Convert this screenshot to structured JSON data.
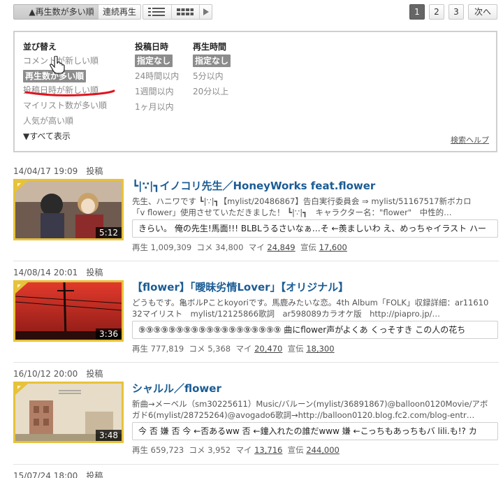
{
  "toolbar": {
    "sort_button": "▲再生数が多い順",
    "continuous_play": "連続再生",
    "pages": [
      "1",
      "2",
      "3"
    ],
    "next": "次へ"
  },
  "filter": {
    "sort": {
      "heading": "並び替え",
      "options": [
        "コメントが新しい順",
        "再生数が多い順",
        "投稿日時が新しい順",
        "マイリスト数が多い順",
        "人気が高い順"
      ],
      "show_all": "▼すべて表示"
    },
    "post_date": {
      "heading": "投稿日時",
      "selected": "指定なし",
      "options": [
        "24時間以内",
        "1週間以内",
        "1ヶ月以内"
      ]
    },
    "duration": {
      "heading": "再生時間",
      "selected": "指定なし",
      "options": [
        "5分以内",
        "20分以上"
      ]
    },
    "help": "検索ヘルプ"
  },
  "videos": [
    {
      "date": "14/04/17 19:09",
      "post_label": "投稿",
      "title": "┗|∵|┓イノコリ先生／HoneyWorks feat.flower",
      "desc1": "先生、ハニワです ┗|∵|┓【mylist/20486867】告白実行委員会 ⇒ mylist/51167517新ボカロ",
      "desc2": "「v flower」使用させていただきました！ ┗|∵|┓　キャラクター名：\"flower\"　中性的…",
      "duration": "5:12",
      "comment": "きらい。 俺の先生!馬面!!! BLBLうるさいなぁ…そ ←羨ましいわ え、めっちゃイラスト ハー",
      "views_label": "再生",
      "views": "1,009,309",
      "comments_label": "コメ",
      "comments": "34,800",
      "mylist_label": "マイ",
      "mylist": "24,849",
      "ads_label": "宣伝",
      "ads": "17,600"
    },
    {
      "date": "14/08/14 20:01",
      "post_label": "投稿",
      "title": "【flower】「曖昧劣情Lover」【オリジナル】",
      "desc1": "どうもです。亀ボルPことkoyoriです。馬鹿みたいな恋。4th Album「FOLK」収録詳細：ar11610",
      "desc2": "32マイリスト　mylist/12125866歌詞　ar598089カラオケ版　http://piapro.jp/…",
      "duration": "3:36",
      "comment": "⑨⑨⑨⑨⑨⑨⑨⑨⑨⑨⑨⑨⑨⑨⑨⑨⑨⑨⑨ 曲にflower声がよくあ くっそすき この人の花ち",
      "views_label": "再生",
      "views": "777,819",
      "comments_label": "コメ",
      "comments": "5,368",
      "mylist_label": "マイ",
      "mylist": "20,470",
      "ads_label": "宣伝",
      "ads": "18,300"
    },
    {
      "date": "16/10/12 20:00",
      "post_label": "投稿",
      "title": "シャルル／flower",
      "desc1": "新曲→メーベル（sm30225611）Music/バルーン(mylist/36891867)@balloon0120Movie/アボ",
      "desc2": "ガド6(mylist/28725264)@avogado6歌詞→http://balloon0120.blog.fc2.com/blog-entr…",
      "duration": "3:48",
      "comment": "今 否 嫌 否 今 ←否あるww 否 ←鐘入れたの誰だwww 嫌 ←こっちもあっちもバ lili.も!? カ",
      "views_label": "再生",
      "views": "659,723",
      "comments_label": "コメ",
      "comments": "3,952",
      "mylist_label": "マイ",
      "mylist": "13,716",
      "ads_label": "宣伝",
      "ads": "244,000"
    },
    {
      "date": "15/07/24 18:00",
      "post_label": "投稿"
    }
  ],
  "colors": {
    "title": "#1b5c94",
    "thumb_border": "#e7c23b",
    "selected_bg": "#8c8c8c",
    "annotation": "#e0141e"
  }
}
